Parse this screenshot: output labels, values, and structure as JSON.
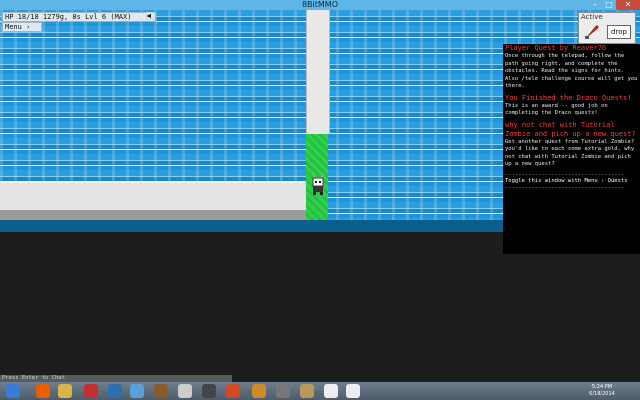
{
  "window": {
    "title": "8BitMMO",
    "min": "–",
    "max": "□",
    "close": "✕"
  },
  "hud": {
    "status": "HP 18/18  1279g, 8s  Lvl 6 (MAX)",
    "sound_icon": "speaker-icon",
    "menu_label": "Menu ›"
  },
  "active": {
    "label": "Active",
    "item_icon": "red-sword-icon",
    "drop_label": "drop"
  },
  "quest_panel": {
    "entries": [
      {
        "title": "Player Quest by Reaver76",
        "body": "Once through the telepad, follow the path going right, and complete the obstacles. Read the signs for hints. Also /tele challenge course will get you there."
      },
      {
        "title": "You Finished the Draco Quests!",
        "body": "This is an award -- good job on completing the Draco quests!"
      },
      {
        "title": " why not chat with Tutorial Zombie and pich up a new quest?",
        "body": "Get another quest from Tutorial Zombie? you'd like to each some extra gold, why not chat with Tutorial Zombie and pich up a new quest?"
      }
    ],
    "divider": "------------------------------------",
    "toggle_text": "Toggle this window with Menu › Quests",
    "divider2": "------------------------------------"
  },
  "chat": {
    "placeholder": "Press Enter to Chat"
  },
  "taskbar": {
    "icons": [
      {
        "name": "start-icon",
        "color": "#3a7bd5"
      },
      {
        "name": "firefox-icon",
        "color": "#e66000"
      },
      {
        "name": "files-icon",
        "color": "#d9b44a"
      },
      {
        "name": "game-icon",
        "color": "#c03030"
      },
      {
        "name": "app-icon-1",
        "color": "#2f6fb0"
      },
      {
        "name": "app-icon-2",
        "color": "#5aa0d8"
      },
      {
        "name": "app-icon-3",
        "color": "#8a5a2a"
      },
      {
        "name": "app-icon-4",
        "color": "#cccccc"
      },
      {
        "name": "app-icon-5",
        "color": "#444444"
      },
      {
        "name": "app-icon-6",
        "color": "#d24a2a"
      },
      {
        "name": "app-icon-7",
        "color": "#cf8a2a"
      },
      {
        "name": "app-icon-8",
        "color": "#777777"
      },
      {
        "name": "app-icon-9",
        "color": "#b89a5a"
      },
      {
        "name": "app-icon-10",
        "color": "#eeeeee"
      },
      {
        "name": "app-icon-11",
        "color": "#eeeeee"
      }
    ],
    "time": "5:24 PM",
    "date": "6/18/2014"
  }
}
